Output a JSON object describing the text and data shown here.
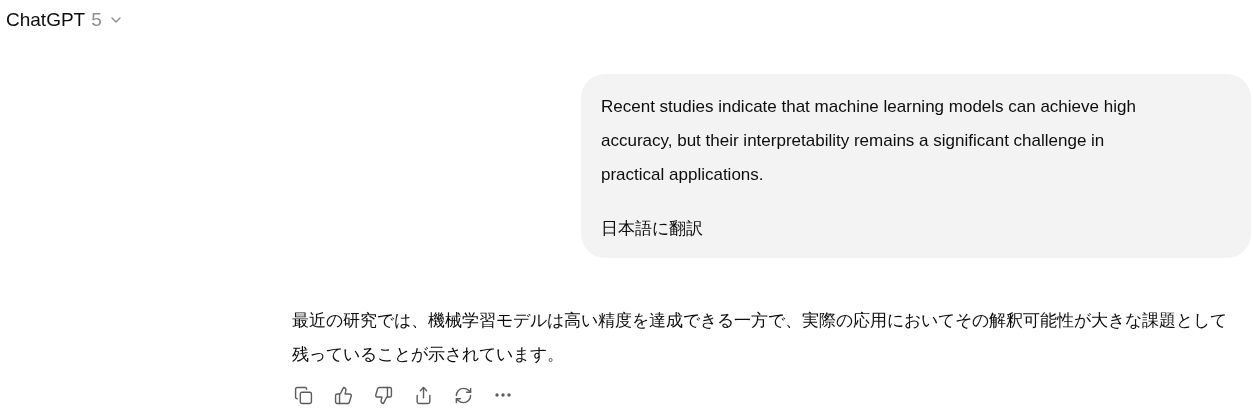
{
  "header": {
    "title": "ChatGPT",
    "version": "5"
  },
  "user_message": {
    "paragraphs": [
      "Recent studies indicate that machine learning models can achieve high accuracy, but their interpretability remains a significant challenge in practical applications.",
      "日本語に翻訳"
    ]
  },
  "assistant_message": {
    "text": "最近の研究では、機械学習モデルは高い精度を達成できる一方で、実際の応用においてその解釈可能性が大きな課題として残っていることが示されています。"
  },
  "actions": [
    {
      "kind": "copy"
    },
    {
      "kind": "like"
    },
    {
      "kind": "dislike"
    },
    {
      "kind": "share"
    },
    {
      "kind": "regenerate"
    },
    {
      "kind": "more"
    }
  ]
}
